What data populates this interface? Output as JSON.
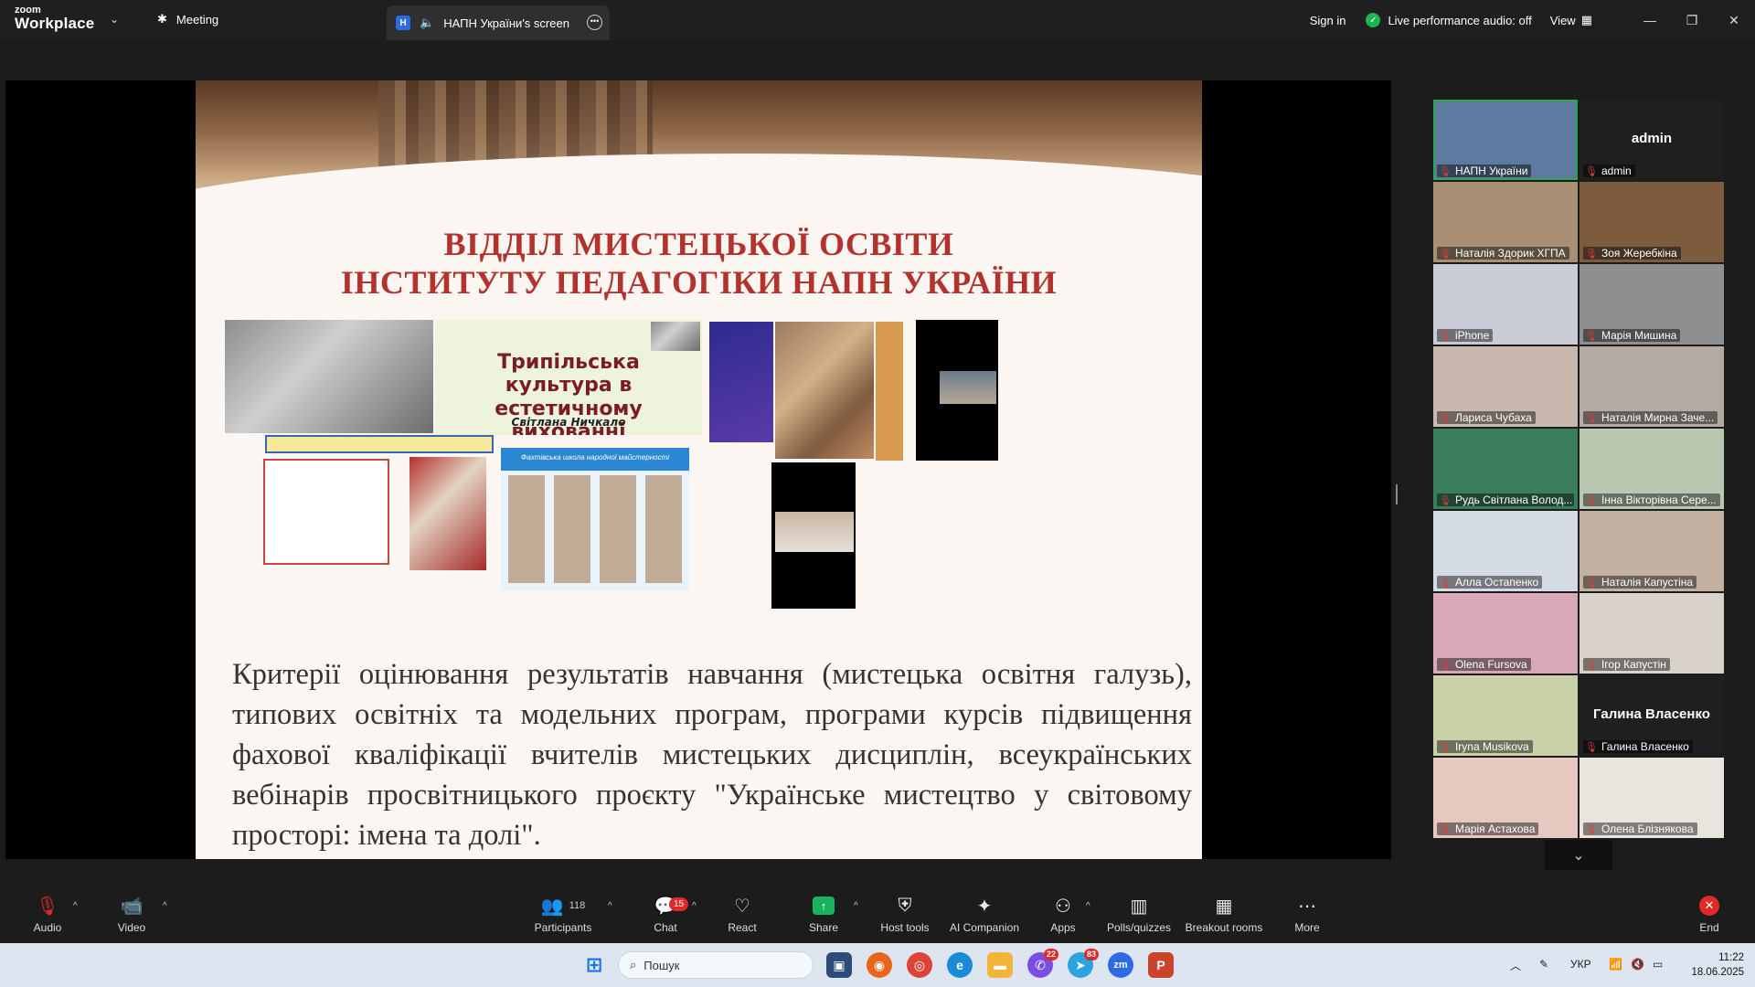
{
  "titlebar": {
    "logo_line1": "zoom",
    "logo_line2": "Workplace",
    "meeting_tab": "Meeting",
    "share_tab_badge": "Н",
    "share_tab": "НАПН України's screen",
    "sign_in": "Sign in",
    "perf_audio": "Live performance audio: off",
    "view": "View"
  },
  "slide": {
    "title_line1": "ВІДДІЛ МИСТЕЦЬКОЇ ОСВІТИ",
    "title_line2": "ІНСТИТУТУ ПЕДАГОГІКИ НАПН УКРАЇНИ",
    "tripilska_title": "Трипільська культура в естетичному вихованні школярів: акценти",
    "tripilska_author": "Світлана Ничкало",
    "fakt_school": "Фахтівська школа народної майстерності",
    "body": "Критерії оцінювання результатів навчання (мистецька освітня галузь), типових освітніх та модельних програм, програми курсів підвищення фахової кваліфікації вчителів мистецьких дисциплін, всеукраїнських вебінарів просвітницького проєкту \"Українське мистецтво у світовому просторі: імена та долі\"."
  },
  "gallery": {
    "participants": [
      {
        "name": "НАПН України",
        "bg": "#5d7aa0",
        "big": ""
      },
      {
        "name": "admin",
        "bg": "#1f1f1f",
        "big": "admin"
      },
      {
        "name": "Наталія Здорик ХГПА",
        "bg": "#a88f74",
        "big": ""
      },
      {
        "name": "Зоя Жеребкіна",
        "bg": "#7d5b3f",
        "big": ""
      },
      {
        "name": "iPhone",
        "bg": "#c9ccd6",
        "big": ""
      },
      {
        "name": "Марія Мишина",
        "bg": "#8f8f8f",
        "big": ""
      },
      {
        "name": "Лариса Чубаха",
        "bg": "#c8b8ad",
        "big": ""
      },
      {
        "name": "Наталія Мирна Заче...",
        "bg": "#b2aaa3",
        "big": ""
      },
      {
        "name": "Рудь Світлана Волод...",
        "bg": "#3a7d5a",
        "big": ""
      },
      {
        "name": "Інна Вікторівна Сере...",
        "bg": "#b8c8b0",
        "big": ""
      },
      {
        "name": "Алла Остапенко",
        "bg": "#d5dbe2",
        "big": ""
      },
      {
        "name": "Наталія Капустіна",
        "bg": "#c3b2a4",
        "big": ""
      },
      {
        "name": "Olena Fursova",
        "bg": "#d8a8b8",
        "big": ""
      },
      {
        "name": "Ігор Капустін",
        "bg": "#d8d2c8",
        "big": ""
      },
      {
        "name": "Iryna Musikova",
        "bg": "#c9d0a8",
        "big": ""
      },
      {
        "name": "Галина Власенко",
        "bg": "#1f1f1f",
        "big": "Галина Власенко"
      },
      {
        "name": "Марія Астахова",
        "bg": "#e6c8c0",
        "big": ""
      },
      {
        "name": "Олена Блізнякова",
        "bg": "#e9e4de",
        "big": ""
      }
    ]
  },
  "toolbar": {
    "audio": "Audio",
    "video": "Video",
    "participants": "Participants",
    "participants_count": "118",
    "chat": "Chat",
    "chat_badge": "15",
    "react": "React",
    "share": "Share",
    "host_tools": "Host tools",
    "ai_companion": "AI Companion",
    "apps": "Apps",
    "polls": "Polls/quizzes",
    "breakout": "Breakout rooms",
    "more": "More",
    "end": "End"
  },
  "taskbar": {
    "search": "Пошук",
    "viber_badge": "22",
    "telegram_badge": "83",
    "lang": "УКР",
    "time": "11:22",
    "date": "18.06.2025"
  },
  "colors": {
    "accent_green": "#1db34f",
    "danger_red": "#e02a2a",
    "slide_title_red": "#b2332d"
  }
}
